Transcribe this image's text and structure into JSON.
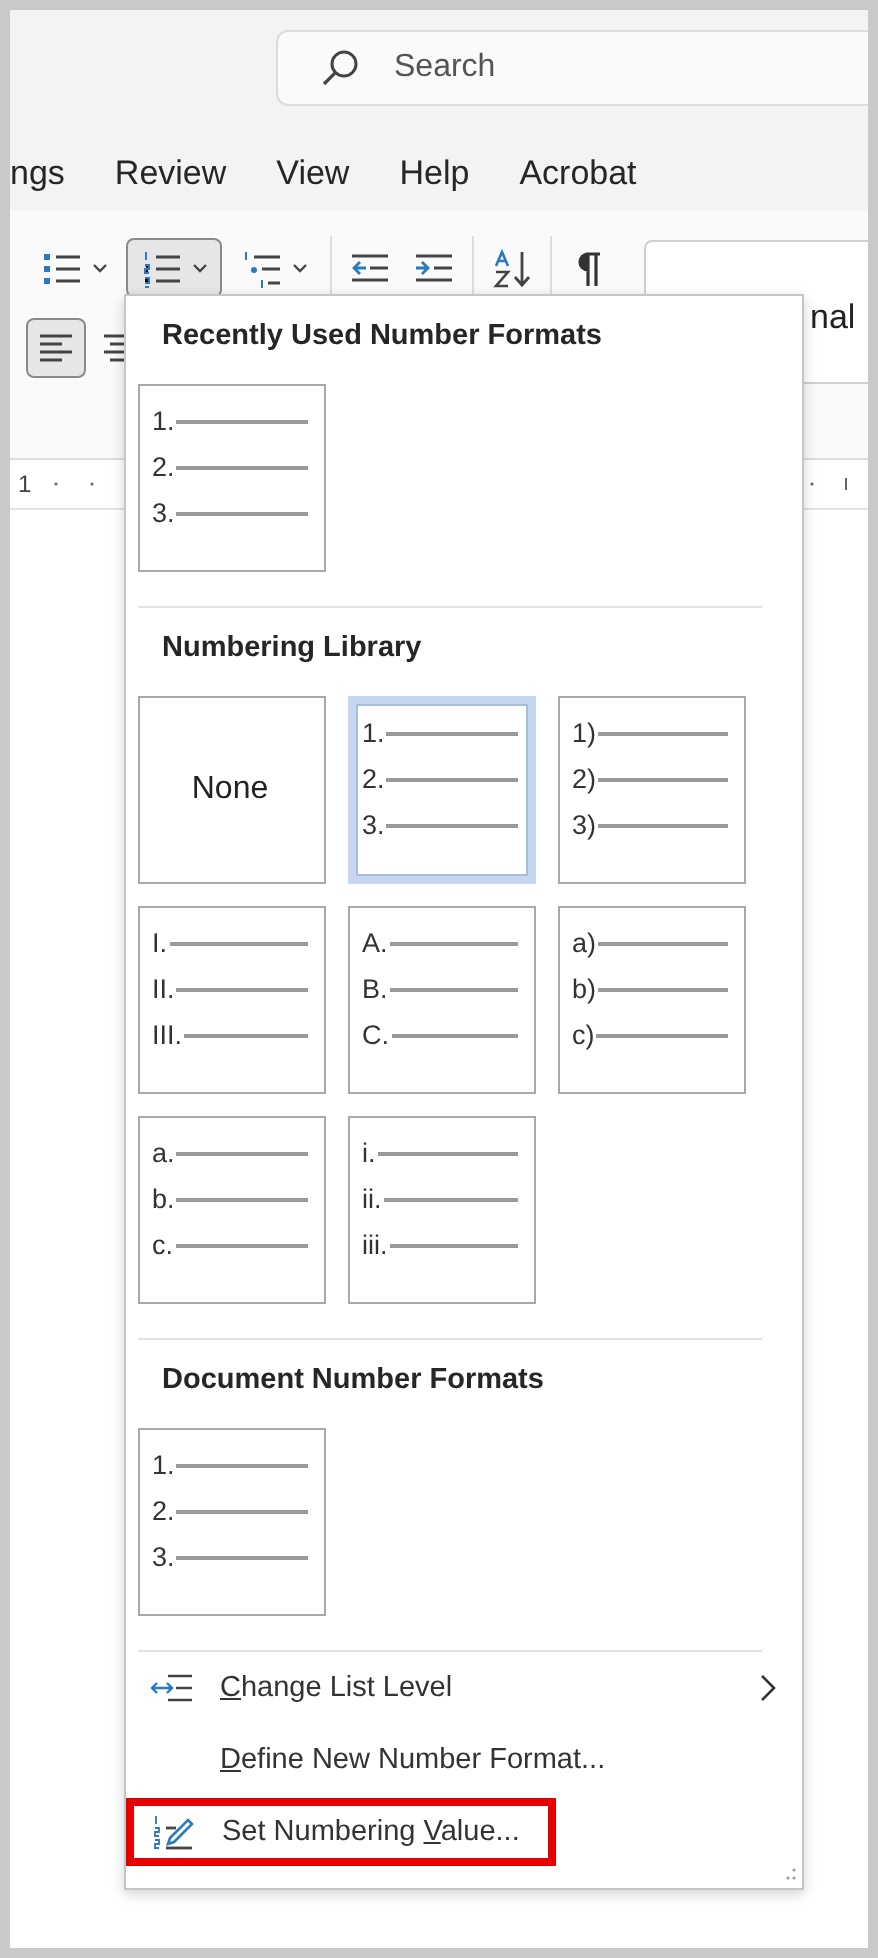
{
  "search": {
    "placeholder": "Search"
  },
  "tabs": [
    {
      "label": "ngs",
      "selected": false
    },
    {
      "label": "Review",
      "selected": false
    },
    {
      "label": "View",
      "selected": false
    },
    {
      "label": "Help",
      "selected": false
    },
    {
      "label": "Acrobat",
      "selected": false
    }
  ],
  "ribbon": {
    "row_1": [
      [
        {
          "kind": "bullets",
          "dropdown": true,
          "selected": false
        },
        {
          "kind": "numbering",
          "dropdown": true,
          "selected": true
        },
        {
          "kind": "multilevel",
          "dropdown": true,
          "selected": false
        }
      ],
      [
        {
          "kind": "outdent",
          "dropdown": false,
          "selected": false
        },
        {
          "kind": "indent",
          "dropdown": false,
          "selected": false
        }
      ],
      [
        {
          "kind": "sort",
          "dropdown": false,
          "selected": false
        }
      ],
      [
        {
          "kind": "pilcrow",
          "dropdown": false,
          "selected": false
        }
      ]
    ],
    "row_2": [
      {
        "kind": "align_left",
        "dropdown": false,
        "selected": true
      },
      {
        "kind": "align_center",
        "dropdown": false,
        "selected": false
      }
    ],
    "style_gallery": {
      "label": "nal"
    }
  },
  "ruler": {
    "label": "1"
  },
  "numbering_menu": {
    "sections": [
      {
        "title": "Recently Used Number Formats",
        "tiles": [
          {
            "kind": "list",
            "selected": false,
            "markers": [
              "1.",
              "2.",
              "3."
            ]
          }
        ]
      },
      {
        "title": "Numbering Library",
        "tiles": [
          {
            "kind": "none",
            "selected": false,
            "label": "None"
          },
          {
            "kind": "list",
            "selected": true,
            "markers": [
              "1.",
              "2.",
              "3."
            ]
          },
          {
            "kind": "list",
            "selected": false,
            "markers": [
              "1)",
              "2)",
              "3)"
            ]
          },
          {
            "kind": "list",
            "selected": false,
            "markers": [
              "I.",
              "II.",
              "III."
            ]
          },
          {
            "kind": "list",
            "selected": false,
            "markers": [
              "A.",
              "B.",
              "C."
            ]
          },
          {
            "kind": "list",
            "selected": false,
            "markers": [
              "a)",
              "b)",
              "c)"
            ]
          },
          {
            "kind": "list",
            "selected": false,
            "markers": [
              "a.",
              "b.",
              "c."
            ]
          },
          {
            "kind": "list",
            "selected": false,
            "markers": [
              "i.",
              "ii.",
              "iii."
            ]
          }
        ]
      },
      {
        "title": "Document Number Formats",
        "tiles": [
          {
            "kind": "list",
            "selected": false,
            "markers": [
              "1.",
              "2.",
              "3."
            ]
          }
        ]
      }
    ],
    "items": [
      {
        "kind": "change_level",
        "access_key": "C",
        "label_rest": "hange List Level",
        "submenu": true,
        "highlighted": false
      },
      {
        "kind": "define",
        "access_key": "D",
        "label_rest": "efine New Number Format...",
        "submenu": false,
        "highlighted": false
      },
      {
        "kind": "set_value",
        "label_start": "Set Numbering ",
        "access_key": "V",
        "label_rest": "alue...",
        "submenu": false,
        "highlighted": true
      }
    ]
  }
}
